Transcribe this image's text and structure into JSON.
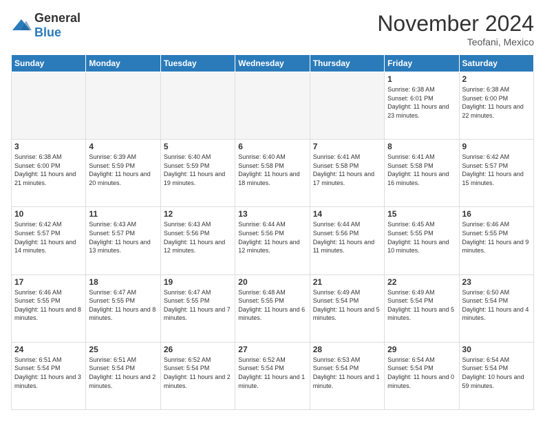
{
  "logo": {
    "general": "General",
    "blue": "Blue"
  },
  "title": "November 2024",
  "location": "Teofani, Mexico",
  "days": [
    "Sunday",
    "Monday",
    "Tuesday",
    "Wednesday",
    "Thursday",
    "Friday",
    "Saturday"
  ],
  "rows": [
    [
      {
        "day": "",
        "text": ""
      },
      {
        "day": "",
        "text": ""
      },
      {
        "day": "",
        "text": ""
      },
      {
        "day": "",
        "text": ""
      },
      {
        "day": "",
        "text": ""
      },
      {
        "day": "1",
        "text": "Sunrise: 6:38 AM\nSunset: 6:01 PM\nDaylight: 11 hours and 23 minutes."
      },
      {
        "day": "2",
        "text": "Sunrise: 6:38 AM\nSunset: 6:00 PM\nDaylight: 11 hours and 22 minutes."
      }
    ],
    [
      {
        "day": "3",
        "text": "Sunrise: 6:38 AM\nSunset: 6:00 PM\nDaylight: 11 hours and 21 minutes."
      },
      {
        "day": "4",
        "text": "Sunrise: 6:39 AM\nSunset: 5:59 PM\nDaylight: 11 hours and 20 minutes."
      },
      {
        "day": "5",
        "text": "Sunrise: 6:40 AM\nSunset: 5:59 PM\nDaylight: 11 hours and 19 minutes."
      },
      {
        "day": "6",
        "text": "Sunrise: 6:40 AM\nSunset: 5:58 PM\nDaylight: 11 hours and 18 minutes."
      },
      {
        "day": "7",
        "text": "Sunrise: 6:41 AM\nSunset: 5:58 PM\nDaylight: 11 hours and 17 minutes."
      },
      {
        "day": "8",
        "text": "Sunrise: 6:41 AM\nSunset: 5:58 PM\nDaylight: 11 hours and 16 minutes."
      },
      {
        "day": "9",
        "text": "Sunrise: 6:42 AM\nSunset: 5:57 PM\nDaylight: 11 hours and 15 minutes."
      }
    ],
    [
      {
        "day": "10",
        "text": "Sunrise: 6:42 AM\nSunset: 5:57 PM\nDaylight: 11 hours and 14 minutes."
      },
      {
        "day": "11",
        "text": "Sunrise: 6:43 AM\nSunset: 5:57 PM\nDaylight: 11 hours and 13 minutes."
      },
      {
        "day": "12",
        "text": "Sunrise: 6:43 AM\nSunset: 5:56 PM\nDaylight: 11 hours and 12 minutes."
      },
      {
        "day": "13",
        "text": "Sunrise: 6:44 AM\nSunset: 5:56 PM\nDaylight: 11 hours and 12 minutes."
      },
      {
        "day": "14",
        "text": "Sunrise: 6:44 AM\nSunset: 5:56 PM\nDaylight: 11 hours and 11 minutes."
      },
      {
        "day": "15",
        "text": "Sunrise: 6:45 AM\nSunset: 5:55 PM\nDaylight: 11 hours and 10 minutes."
      },
      {
        "day": "16",
        "text": "Sunrise: 6:46 AM\nSunset: 5:55 PM\nDaylight: 11 hours and 9 minutes."
      }
    ],
    [
      {
        "day": "17",
        "text": "Sunrise: 6:46 AM\nSunset: 5:55 PM\nDaylight: 11 hours and 8 minutes."
      },
      {
        "day": "18",
        "text": "Sunrise: 6:47 AM\nSunset: 5:55 PM\nDaylight: 11 hours and 8 minutes."
      },
      {
        "day": "19",
        "text": "Sunrise: 6:47 AM\nSunset: 5:55 PM\nDaylight: 11 hours and 7 minutes."
      },
      {
        "day": "20",
        "text": "Sunrise: 6:48 AM\nSunset: 5:55 PM\nDaylight: 11 hours and 6 minutes."
      },
      {
        "day": "21",
        "text": "Sunrise: 6:49 AM\nSunset: 5:54 PM\nDaylight: 11 hours and 5 minutes."
      },
      {
        "day": "22",
        "text": "Sunrise: 6:49 AM\nSunset: 5:54 PM\nDaylight: 11 hours and 5 minutes."
      },
      {
        "day": "23",
        "text": "Sunrise: 6:50 AM\nSunset: 5:54 PM\nDaylight: 11 hours and 4 minutes."
      }
    ],
    [
      {
        "day": "24",
        "text": "Sunrise: 6:51 AM\nSunset: 5:54 PM\nDaylight: 11 hours and 3 minutes."
      },
      {
        "day": "25",
        "text": "Sunrise: 6:51 AM\nSunset: 5:54 PM\nDaylight: 11 hours and 2 minutes."
      },
      {
        "day": "26",
        "text": "Sunrise: 6:52 AM\nSunset: 5:54 PM\nDaylight: 11 hours and 2 minutes."
      },
      {
        "day": "27",
        "text": "Sunrise: 6:52 AM\nSunset: 5:54 PM\nDaylight: 11 hours and 1 minute."
      },
      {
        "day": "28",
        "text": "Sunrise: 6:53 AM\nSunset: 5:54 PM\nDaylight: 11 hours and 1 minute."
      },
      {
        "day": "29",
        "text": "Sunrise: 6:54 AM\nSunset: 5:54 PM\nDaylight: 11 hours and 0 minutes."
      },
      {
        "day": "30",
        "text": "Sunrise: 6:54 AM\nSunset: 5:54 PM\nDaylight: 10 hours and 59 minutes."
      }
    ]
  ]
}
